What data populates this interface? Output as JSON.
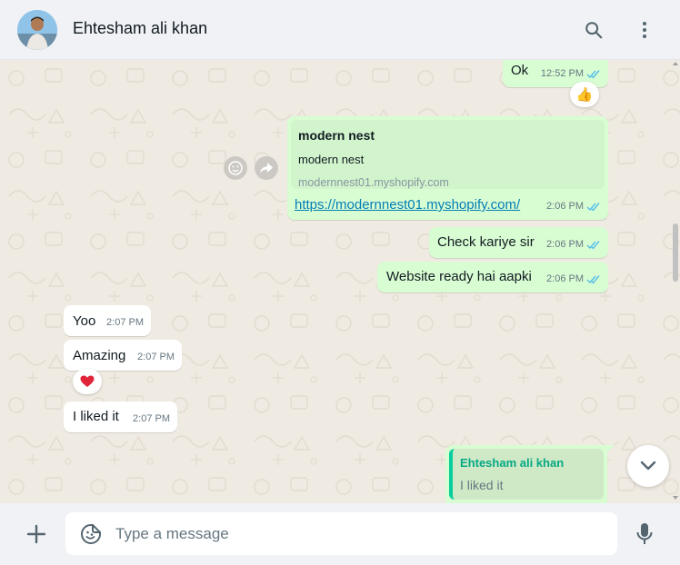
{
  "header": {
    "contact_name": "Ehtesham ali khan",
    "search_icon": "search-icon",
    "menu_icon": "kebab-menu-icon"
  },
  "messages": [
    {
      "direction": "out",
      "text": "Ok",
      "time": "12:52 PM",
      "status": "read",
      "reaction": "👍"
    },
    {
      "direction": "out",
      "type": "link",
      "preview": {
        "title": "modern nest",
        "description": "modern nest",
        "domain": "modernnest01.myshopify.com"
      },
      "text": "https://modernnest01.myshopify.com/",
      "time": "2:06 PM",
      "status": "read"
    },
    {
      "direction": "out",
      "text": "Check kariye sir",
      "time": "2:06 PM",
      "status": "read"
    },
    {
      "direction": "out",
      "text": "Website ready hai aapki",
      "time": "2:06 PM",
      "status": "read"
    },
    {
      "direction": "in",
      "text": "Yoo",
      "time": "2:07 PM"
    },
    {
      "direction": "in",
      "text": "Amazing",
      "time": "2:07 PM",
      "reaction": "❤️"
    },
    {
      "direction": "in",
      "text": "I liked it",
      "time": "2:07 PM"
    },
    {
      "direction": "out",
      "type": "reply",
      "quote": {
        "author": "Ehtesham ali khan",
        "text": "I liked it"
      }
    }
  ],
  "composer": {
    "placeholder": "Type a message",
    "value": ""
  },
  "colors": {
    "outgoing_bubble": "#d9fdd3",
    "incoming_bubble": "#ffffff",
    "read_ticks": "#53bdeb",
    "chat_background": "#efeae2",
    "header_background": "#f0f2f5",
    "quote_accent": "#06cf9c"
  }
}
